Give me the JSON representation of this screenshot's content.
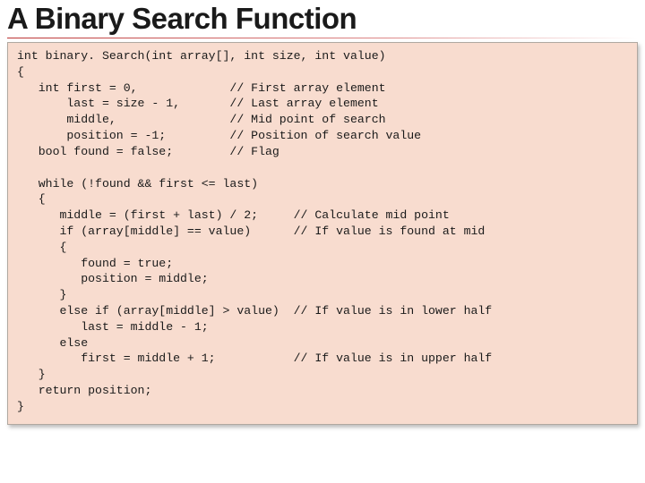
{
  "slide": {
    "title": "A Binary Search Function",
    "code": "int binary. Search(int array[], int size, int value)\n{\n   int first = 0,             // First array element\n       last = size - 1,       // Last array element\n       middle,                // Mid point of search\n       position = -1;         // Position of search value\n   bool found = false;        // Flag\n\n   while (!found && first <= last)\n   {\n      middle = (first + last) / 2;     // Calculate mid point\n      if (array[middle] == value)      // If value is found at mid\n      {\n         found = true;\n         position = middle;\n      }\n      else if (array[middle] > value)  // If value is in lower half\n         last = middle - 1;\n      else\n         first = middle + 1;           // If value is in upper half\n   }\n   return position;\n}"
  }
}
